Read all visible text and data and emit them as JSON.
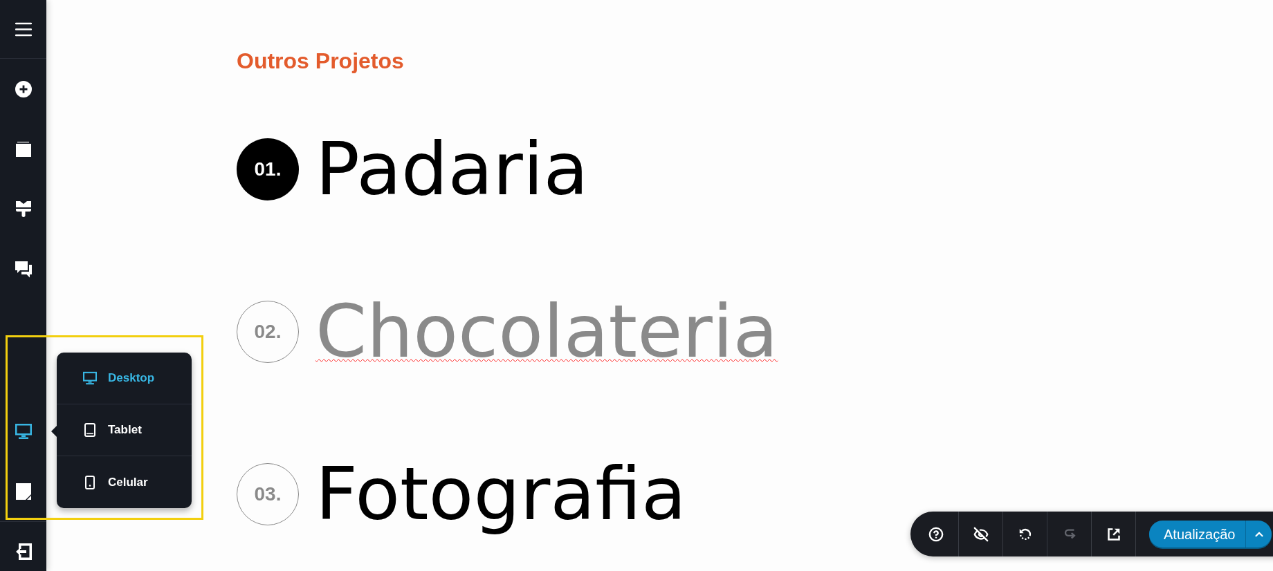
{
  "sidebar": {
    "device_button": {
      "active": true
    }
  },
  "device_menu": {
    "open": true,
    "options": [
      {
        "label": "Desktop",
        "selected": true
      },
      {
        "label": "Tablet",
        "selected": false
      },
      {
        "label": "Celular",
        "selected": false
      }
    ]
  },
  "section": {
    "title": "Outros Projetos",
    "projects": [
      {
        "number": "01.",
        "name": "Padaria",
        "selected": true,
        "faded": false,
        "misspelled": false
      },
      {
        "number": "02.",
        "name": "Chocolateria",
        "selected": false,
        "faded": true,
        "misspelled": true
      },
      {
        "number": "03.",
        "name": "Fotografia",
        "selected": false,
        "faded": false,
        "misspelled": false
      }
    ]
  },
  "toolbar": {
    "buttons": [
      {
        "disabled": false
      },
      {
        "disabled": false
      },
      {
        "disabled": false
      },
      {
        "disabled": true
      },
      {
        "disabled": false
      }
    ],
    "update_button": {
      "label": "Atualização"
    }
  }
}
